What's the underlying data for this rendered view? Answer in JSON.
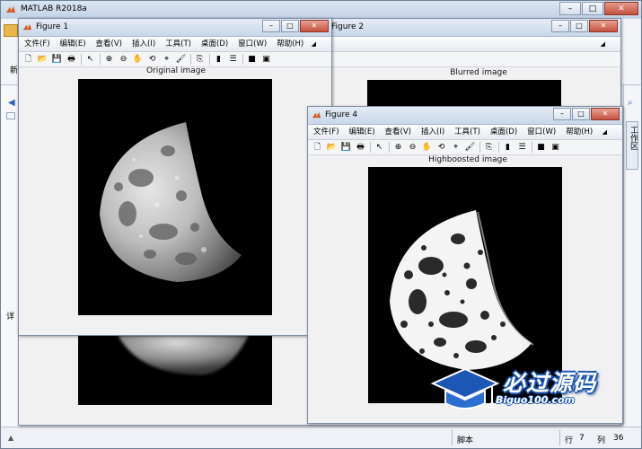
{
  "main_window": {
    "title": "MATLAB R2018a",
    "controls": [
      "–",
      "□",
      "✕"
    ],
    "ribbon_new_label": "新",
    "left_panel_label": "详",
    "right_panel_tab": "工作区"
  },
  "statusbar": {
    "mode": "脚本",
    "row_label": "行",
    "row_value": "7",
    "col_label": "列",
    "col_value": "36"
  },
  "menu_items": [
    "文件(F)",
    "编辑(E)",
    "查看(V)",
    "插入(I)",
    "工具(T)",
    "桌面(D)",
    "窗口(W)",
    "帮助(H)"
  ],
  "toolbar_icons": [
    "new-file-icon",
    "open-folder-icon",
    "save-icon",
    "print-icon",
    "pointer-icon",
    "zoom-in-icon",
    "zoom-out-icon",
    "pan-hand-icon",
    "rotate-3d-icon",
    "data-cursor-icon",
    "brush-icon",
    "link-plot-icon",
    "colorbar-icon",
    "legend-icon",
    "hide-plot-tools-icon",
    "show-plot-tools-icon"
  ],
  "figures": {
    "fig1": {
      "title": "Figure 1",
      "axes_title": "Original image"
    },
    "fig2": {
      "title": "Figure 2",
      "axes_title": "Blurred image"
    },
    "fig4": {
      "title": "Figure 4",
      "axes_title": "Highboosted image"
    }
  },
  "watermark": {
    "cn": "必过源码",
    "en": "Biguo100.com"
  },
  "colors": {
    "title_bar": "#c9d7ea",
    "figure_bg": "#f1f1f1",
    "close_button": "#c7513f",
    "watermark_blue": "#1c57b6"
  }
}
